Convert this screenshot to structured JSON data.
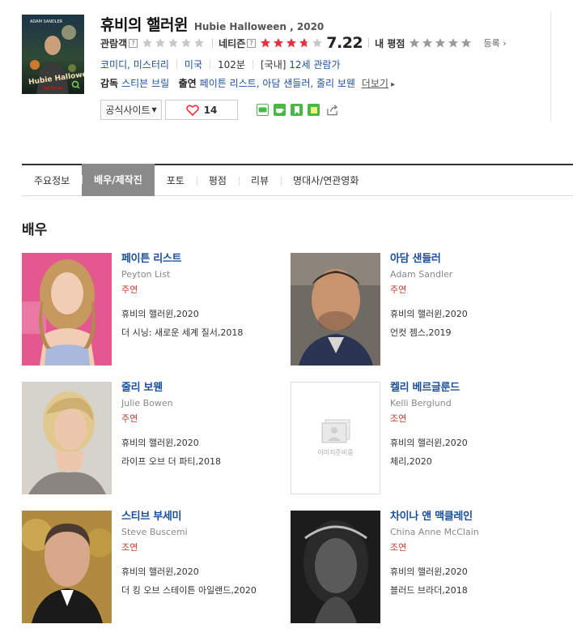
{
  "movie": {
    "title_ko": "휴비의 핼러윈",
    "title_en": "Hubie Halloween , 2020",
    "poster_text": "Hubie Halloween!",
    "poster_top": "ADAM SANDLER",
    "poster_brand": "NETFLIX"
  },
  "ratings": {
    "audience_label": "관람객",
    "audience_q": "?",
    "netizen_label": "네티즌",
    "netizen_q": "?",
    "netizen_score": "7.22",
    "netizen_score_value": 7.22,
    "my_label": "내 평점",
    "register": "등록"
  },
  "info": {
    "genre": "코미디, 미스터리",
    "country": "미국",
    "runtime": "102분",
    "grade_prefix": "[국내]",
    "grade": "12세 관람가"
  },
  "crew": {
    "director_label": "감독",
    "director": "스티븐 브릴",
    "cast_label": "출연",
    "cast": "페이튼 리스트, 아담 샌들러, 줄리 보웬",
    "more": "더보기"
  },
  "actions": {
    "official_site": "공식사이트",
    "like_count": "14"
  },
  "tabs": [
    {
      "label": "주요정보"
    },
    {
      "label": "배우/제작진"
    },
    {
      "label": "포토"
    },
    {
      "label": "평점"
    },
    {
      "label": "리뷰"
    },
    {
      "label": "명대사/연관영화"
    }
  ],
  "section": {
    "title": "배우"
  },
  "actors": [
    {
      "name_ko": "페이튼 리스트",
      "name_en": "Peyton List",
      "role": "주연",
      "films": [
        "휴비의 핼러윈,2020",
        "더 시닝: 새로운 세계 질서,2018"
      ]
    },
    {
      "name_ko": "아담 샌들러",
      "name_en": "Adam Sandler",
      "role": "주연",
      "films": [
        "휴비의 핼러윈,2020",
        "언컷 젬스,2019"
      ]
    },
    {
      "name_ko": "줄리 보웬",
      "name_en": "Julie Bowen",
      "role": "주연",
      "films": [
        "휴비의 핼러윈,2020",
        "라이프 오브 더 파티,2018"
      ]
    },
    {
      "name_ko": "켈리 베르글룬드",
      "name_en": "Kelli Berglund",
      "role": "조연",
      "films": [
        "휴비의 핼러윈,2020",
        "체리,2020"
      ],
      "no_image": "이미지준비중"
    },
    {
      "name_ko": "스티브 부세미",
      "name_en": "Steve Buscemi",
      "role": "조연",
      "films": [
        "휴비의 핼러윈,2020",
        "더 킹 오브 스테이튼 아일랜드,2020"
      ]
    },
    {
      "name_ko": "차이나 앤 맥클레인",
      "name_en": "China Anne McClain",
      "role": "조연",
      "films": [
        "휴비의 핼러윈,2020",
        "블러드 브라더,2018"
      ]
    }
  ],
  "colors": {
    "link": "#1b4f9a",
    "role": "#c0392b",
    "star_filled": "#e8303e",
    "star_empty": "#c8c8c8",
    "active_tab": "#8a8a8a"
  }
}
